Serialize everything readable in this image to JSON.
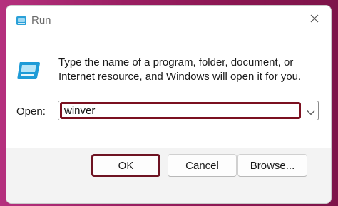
{
  "window": {
    "title": "Run"
  },
  "dialog": {
    "description": "Type the name of a program, folder, document, or Internet resource, and Windows will open it for you.",
    "open_label": "Open:",
    "open_value": "winver"
  },
  "buttons": {
    "ok": "OK",
    "cancel": "Cancel",
    "browse": "Browse..."
  },
  "icons": {
    "title": "run-icon",
    "close": "close-icon",
    "dropdown": "chevron-down-icon",
    "main": "run-app-icon"
  },
  "colors": {
    "highlight": "#7b1020",
    "accent_icon": "#1e9bd7"
  }
}
